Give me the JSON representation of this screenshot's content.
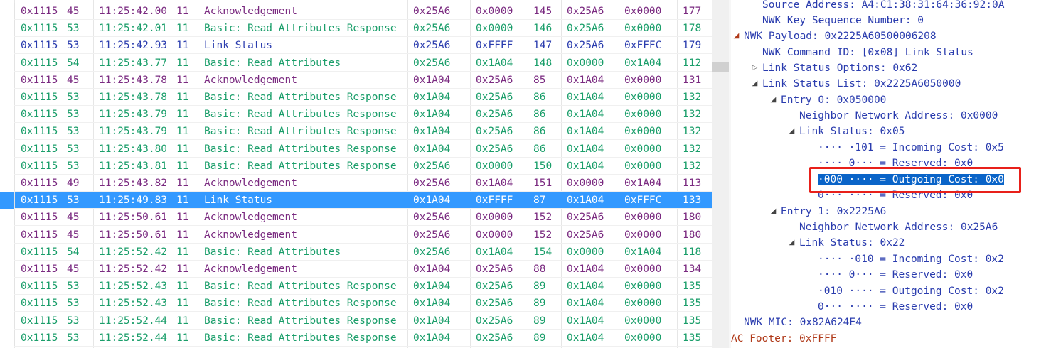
{
  "packet_list": {
    "rows": [
      {
        "cells": [
          "0x1115",
          "45",
          "11:25:42.00",
          "11",
          "Acknowledgement",
          "0x25A6",
          "0x0000",
          "145",
          "0x25A6",
          "0x0000",
          "177"
        ],
        "color": "purple",
        "selected": false
      },
      {
        "cells": [
          "0x1115",
          "53",
          "11:25:42.01",
          "11",
          "Basic: Read Attributes Response",
          "0x25A6",
          "0x0000",
          "146",
          "0x25A6",
          "0x0000",
          "178"
        ],
        "color": "green",
        "selected": false
      },
      {
        "cells": [
          "0x1115",
          "53",
          "11:25:42.93",
          "11",
          "Link Status",
          "0x25A6",
          "0xFFFF",
          "147",
          "0x25A6",
          "0xFFFC",
          "179"
        ],
        "color": "blue",
        "selected": false
      },
      {
        "cells": [
          "0x1115",
          "54",
          "11:25:43.77",
          "11",
          "Basic: Read Attributes",
          "0x25A6",
          "0x1A04",
          "148",
          "0x0000",
          "0x1A04",
          "112"
        ],
        "color": "green",
        "selected": false
      },
      {
        "cells": [
          "0x1115",
          "45",
          "11:25:43.78",
          "11",
          "Acknowledgement",
          "0x1A04",
          "0x25A6",
          "85",
          "0x1A04",
          "0x0000",
          "131"
        ],
        "color": "purple",
        "selected": false
      },
      {
        "cells": [
          "0x1115",
          "53",
          "11:25:43.78",
          "11",
          "Basic: Read Attributes Response",
          "0x1A04",
          "0x25A6",
          "86",
          "0x1A04",
          "0x0000",
          "132"
        ],
        "color": "green",
        "selected": false
      },
      {
        "cells": [
          "0x1115",
          "53",
          "11:25:43.79",
          "11",
          "Basic: Read Attributes Response",
          "0x1A04",
          "0x25A6",
          "86",
          "0x1A04",
          "0x0000",
          "132"
        ],
        "color": "green",
        "selected": false
      },
      {
        "cells": [
          "0x1115",
          "53",
          "11:25:43.79",
          "11",
          "Basic: Read Attributes Response",
          "0x1A04",
          "0x25A6",
          "86",
          "0x1A04",
          "0x0000",
          "132"
        ],
        "color": "green",
        "selected": false
      },
      {
        "cells": [
          "0x1115",
          "53",
          "11:25:43.80",
          "11",
          "Basic: Read Attributes Response",
          "0x1A04",
          "0x25A6",
          "86",
          "0x1A04",
          "0x0000",
          "132"
        ],
        "color": "green",
        "selected": false
      },
      {
        "cells": [
          "0x1115",
          "53",
          "11:25:43.81",
          "11",
          "Basic: Read Attributes Response",
          "0x25A6",
          "0x0000",
          "150",
          "0x1A04",
          "0x0000",
          "132"
        ],
        "color": "green",
        "selected": false
      },
      {
        "cells": [
          "0x1115",
          "49",
          "11:25:43.82",
          "11",
          "Acknowledgement",
          "0x25A6",
          "0x1A04",
          "151",
          "0x0000",
          "0x1A04",
          "113"
        ],
        "color": "purple",
        "selected": false
      },
      {
        "cells": [
          "0x1115",
          "53",
          "11:25:49.83",
          "11",
          "Link Status",
          "0x1A04",
          "0xFFFF",
          "87",
          "0x1A04",
          "0xFFFC",
          "133"
        ],
        "color": "blue",
        "selected": true
      },
      {
        "cells": [
          "0x1115",
          "45",
          "11:25:50.61",
          "11",
          "Acknowledgement",
          "0x25A6",
          "0x0000",
          "152",
          "0x25A6",
          "0x0000",
          "180"
        ],
        "color": "purple",
        "selected": false
      },
      {
        "cells": [
          "0x1115",
          "45",
          "11:25:50.61",
          "11",
          "Acknowledgement",
          "0x25A6",
          "0x0000",
          "152",
          "0x25A6",
          "0x0000",
          "180"
        ],
        "color": "purple",
        "selected": false
      },
      {
        "cells": [
          "0x1115",
          "54",
          "11:25:52.42",
          "11",
          "Basic: Read Attributes",
          "0x25A6",
          "0x1A04",
          "154",
          "0x0000",
          "0x1A04",
          "118"
        ],
        "color": "green",
        "selected": false
      },
      {
        "cells": [
          "0x1115",
          "45",
          "11:25:52.42",
          "11",
          "Acknowledgement",
          "0x1A04",
          "0x25A6",
          "88",
          "0x1A04",
          "0x0000",
          "134"
        ],
        "color": "purple",
        "selected": false
      },
      {
        "cells": [
          "0x1115",
          "53",
          "11:25:52.43",
          "11",
          "Basic: Read Attributes Response",
          "0x1A04",
          "0x25A6",
          "89",
          "0x1A04",
          "0x0000",
          "135"
        ],
        "color": "green",
        "selected": false
      },
      {
        "cells": [
          "0x1115",
          "53",
          "11:25:52.43",
          "11",
          "Basic: Read Attributes Response",
          "0x1A04",
          "0x25A6",
          "89",
          "0x1A04",
          "0x0000",
          "135"
        ],
        "color": "green",
        "selected": false
      },
      {
        "cells": [
          "0x1115",
          "53",
          "11:25:52.44",
          "11",
          "Basic: Read Attributes Response",
          "0x1A04",
          "0x25A6",
          "89",
          "0x1A04",
          "0x0000",
          "135"
        ],
        "color": "green",
        "selected": false
      },
      {
        "cells": [
          "0x1115",
          "53",
          "11:25:52.44",
          "11",
          "Basic: Read Attributes Response",
          "0x1A04",
          "0x25A6",
          "89",
          "0x1A04",
          "0x0000",
          "135"
        ],
        "color": "green",
        "selected": false
      }
    ]
  },
  "detail_tree": {
    "lines": [
      {
        "text": "Source Address: A4:C1:38:31:64:36:92:0A",
        "twisty": ""
      },
      {
        "text": "NWK Key Sequence Number: 0",
        "twisty": ""
      },
      {
        "text": "NWK Payload: 0x2225A60500006208",
        "twisty": "expanded",
        "twisty_color": "red"
      },
      {
        "text": "NWK Command ID: [0x08] Link Status",
        "twisty": ""
      },
      {
        "text": "Link Status Options: 0x62",
        "twisty": "collapsed"
      },
      {
        "text": "Link Status List: 0x2225A6050000",
        "twisty": "expanded"
      },
      {
        "text": "Entry 0: 0x050000",
        "twisty": "expanded"
      },
      {
        "text": "Neighbor Network Address: 0x0000",
        "twisty": ""
      },
      {
        "text": "Link Status: 0x05",
        "twisty": "expanded"
      },
      {
        "text": "···· ·101 = Incoming Cost: 0x5",
        "twisty": ""
      },
      {
        "text": "···· 0··· = Reserved: 0x0",
        "twisty": ""
      },
      {
        "text": "·000 ···· = Outgoing Cost: 0x0",
        "twisty": "",
        "highlighted": true
      },
      {
        "text": "0··· ···· = Reserved: 0x0",
        "twisty": ""
      },
      {
        "text": "Entry 1: 0x2225A6",
        "twisty": "expanded"
      },
      {
        "text": "Neighbor Network Address: 0x25A6",
        "twisty": ""
      },
      {
        "text": "Link Status: 0x22",
        "twisty": "expanded"
      },
      {
        "text": "···· ·010 = Incoming Cost: 0x2",
        "twisty": ""
      },
      {
        "text": "···· 0··· = Reserved: 0x0",
        "twisty": ""
      },
      {
        "text": "·010 ···· = Outgoing Cost: 0x2",
        "twisty": ""
      },
      {
        "text": "0··· ···· = Reserved: 0x0",
        "twisty": ""
      },
      {
        "text": "NWK MIC: 0x82A624E4",
        "twisty": ""
      },
      {
        "text": "AC Footer: 0xFFFF",
        "twisty": "",
        "color": "red"
      }
    ]
  },
  "icons": {
    "expanded": "triangle-down-right-icon",
    "collapsed": "triangle-right-icon"
  },
  "colors": {
    "selection": "#3399ff",
    "tree_highlight": "#0a64c8",
    "annotation_box": "#e8201a",
    "green_text": "#1a9e6a",
    "purple_text": "#7a2a80",
    "blue_text": "#2a3cae"
  }
}
